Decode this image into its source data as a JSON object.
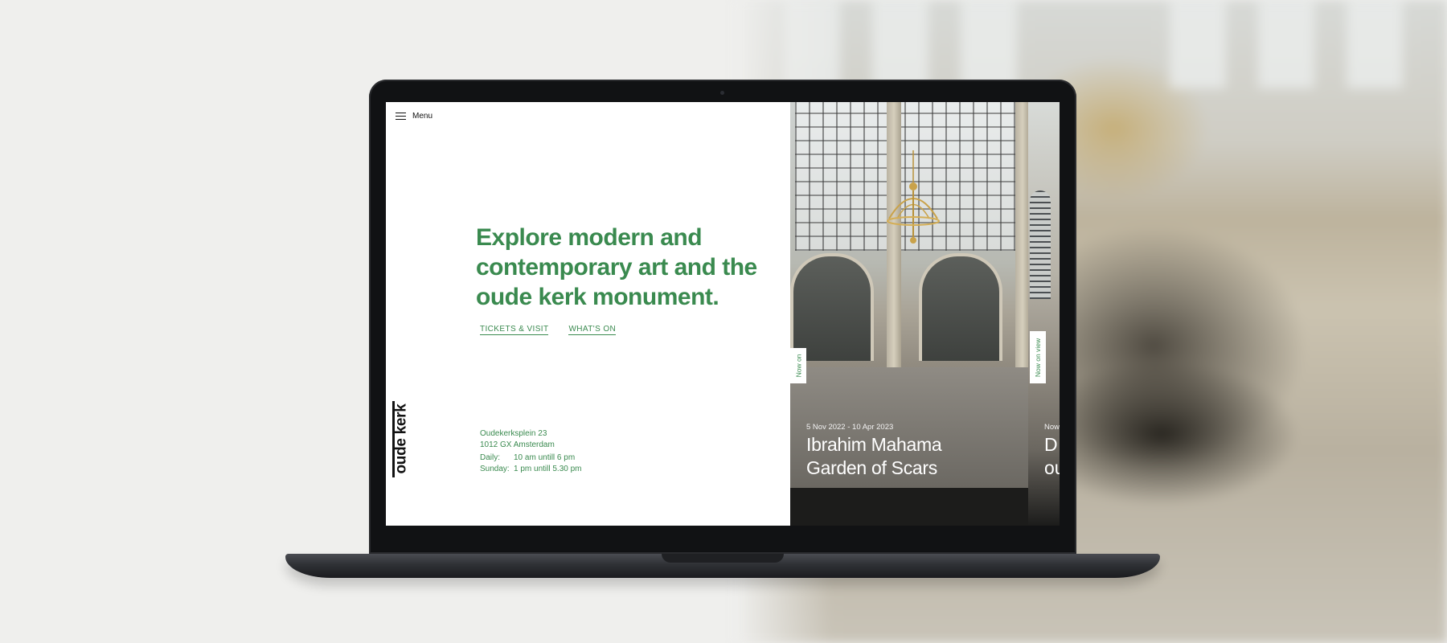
{
  "menu": {
    "label": "Menu"
  },
  "hero": {
    "headline_lines": [
      "Explore modern and",
      "contemporary art and the",
      "oude kerk monument."
    ],
    "links": {
      "tickets": "TICKETS & VISIT",
      "whats_on": "WHAT'S ON"
    }
  },
  "logo": {
    "text": "oude kerk"
  },
  "address": {
    "line1": "Oudekerksplein 23",
    "line2": "1012 GX Amsterdam"
  },
  "hours": [
    {
      "day": "Daily:",
      "time": "10 am untill 6 pm"
    },
    {
      "day": "Sunday:",
      "time": "1 pm untill 5.30 pm"
    }
  ],
  "cards": [
    {
      "tab": "Now on",
      "date": "5 Nov 2022 - 10 Apr 2023",
      "title_lines": [
        "Ibrahim Mahama",
        "Garden of Scars"
      ]
    },
    {
      "tab": "Now on view",
      "date": "Now",
      "title_lines": [
        "D",
        "ou"
      ]
    }
  ],
  "colors": {
    "accent": "#3a8a4f",
    "text_dark": "#111111",
    "background": "#efefed"
  }
}
